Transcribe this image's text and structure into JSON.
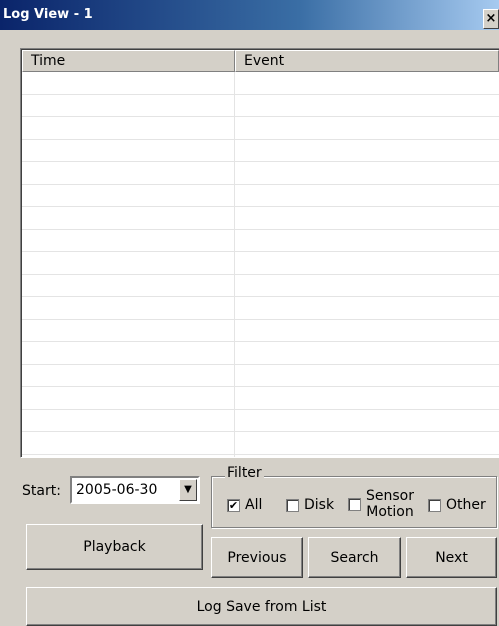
{
  "window": {
    "title": "Log View - 1",
    "close_glyph": "×"
  },
  "list": {
    "columns": [
      "Time",
      "Event"
    ],
    "row_count": 18,
    "rows": []
  },
  "start": {
    "label": "Start:",
    "value": "2005-06-30",
    "arrow_icon": "chevron-down-icon"
  },
  "filter": {
    "legend": "Filter",
    "options": [
      {
        "label": "All",
        "checked": true
      },
      {
        "label": "Disk",
        "checked": false
      },
      {
        "label_line1": "Sensor",
        "label_line2": "Motion",
        "checked": false
      },
      {
        "label": "Other",
        "checked": false
      }
    ]
  },
  "buttons": {
    "playback": "Playback",
    "previous": "Previous",
    "search": "Search",
    "next": "Next",
    "log_save": "Log Save from List"
  },
  "colors": {
    "face": "#d4d0c8",
    "title_start": "#0a246a",
    "title_end": "#a6caf0"
  }
}
